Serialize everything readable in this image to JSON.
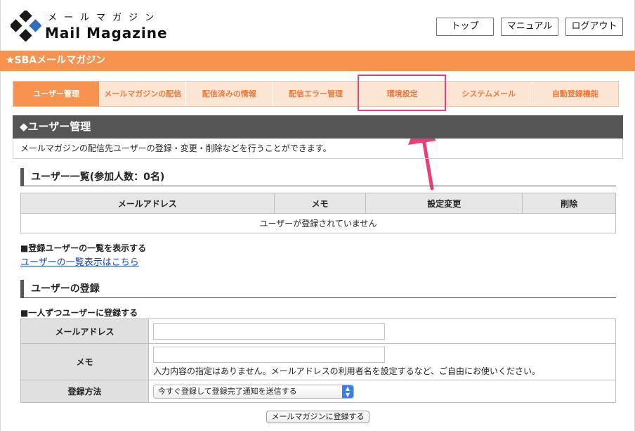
{
  "header": {
    "logo_kana": "メールマガジン",
    "logo_name": "Mail Magazine",
    "buttons": {
      "top": "トップ",
      "manual": "マニュアル",
      "logout": "ログアウト"
    }
  },
  "banner": {
    "title": "★SBAメールマガジン"
  },
  "nav": {
    "tabs": [
      {
        "label": "ユーザー管理",
        "active": true
      },
      {
        "label": "メールマガジンの配信",
        "active": false
      },
      {
        "label": "配信済みの情報",
        "active": false
      },
      {
        "label": "配信エラー管理",
        "active": false
      },
      {
        "label": "環境設定",
        "active": false
      },
      {
        "label": "システムメール",
        "active": false
      },
      {
        "label": "自動登録機能",
        "active": false
      }
    ]
  },
  "section": {
    "title": "◆ユーザー管理",
    "description": "メールマガジンの配信先ユーザーの登録・変更・削除などを行うことができます。"
  },
  "user_list": {
    "heading": "ユーザー一覧(参加人数：0名)",
    "columns": [
      "メールアドレス",
      "メモ",
      "設定変更",
      "削除"
    ],
    "empty_message": "ユーザーが登録されていません",
    "show_label": "■登録ユーザーの一覧を表示する",
    "link": "ユーザーの一覧表示はこちら"
  },
  "registration": {
    "heading": "ユーザーの登録",
    "one_by_one_label": "■一人ずつユーザーに登録する",
    "fields": {
      "email_label": "メールアドレス",
      "email_value": "",
      "memo_label": "メモ",
      "memo_value": "",
      "memo_hint": "入力内容の指定はありません。メールアドレスの利用者名を設定するなど、ご自由にお使いください。",
      "method_label": "登録方法",
      "method_selected": "今すぐ登録して登録完了通知を送信する"
    },
    "submit": "メールマガジンに登録する"
  },
  "colors": {
    "accent": "#f7924f",
    "tab_bg": "#fde5d3",
    "tab_text": "#e87a3e",
    "highlight": "#ee3b7c",
    "dark_header": "#555555",
    "link": "#1144cc"
  }
}
